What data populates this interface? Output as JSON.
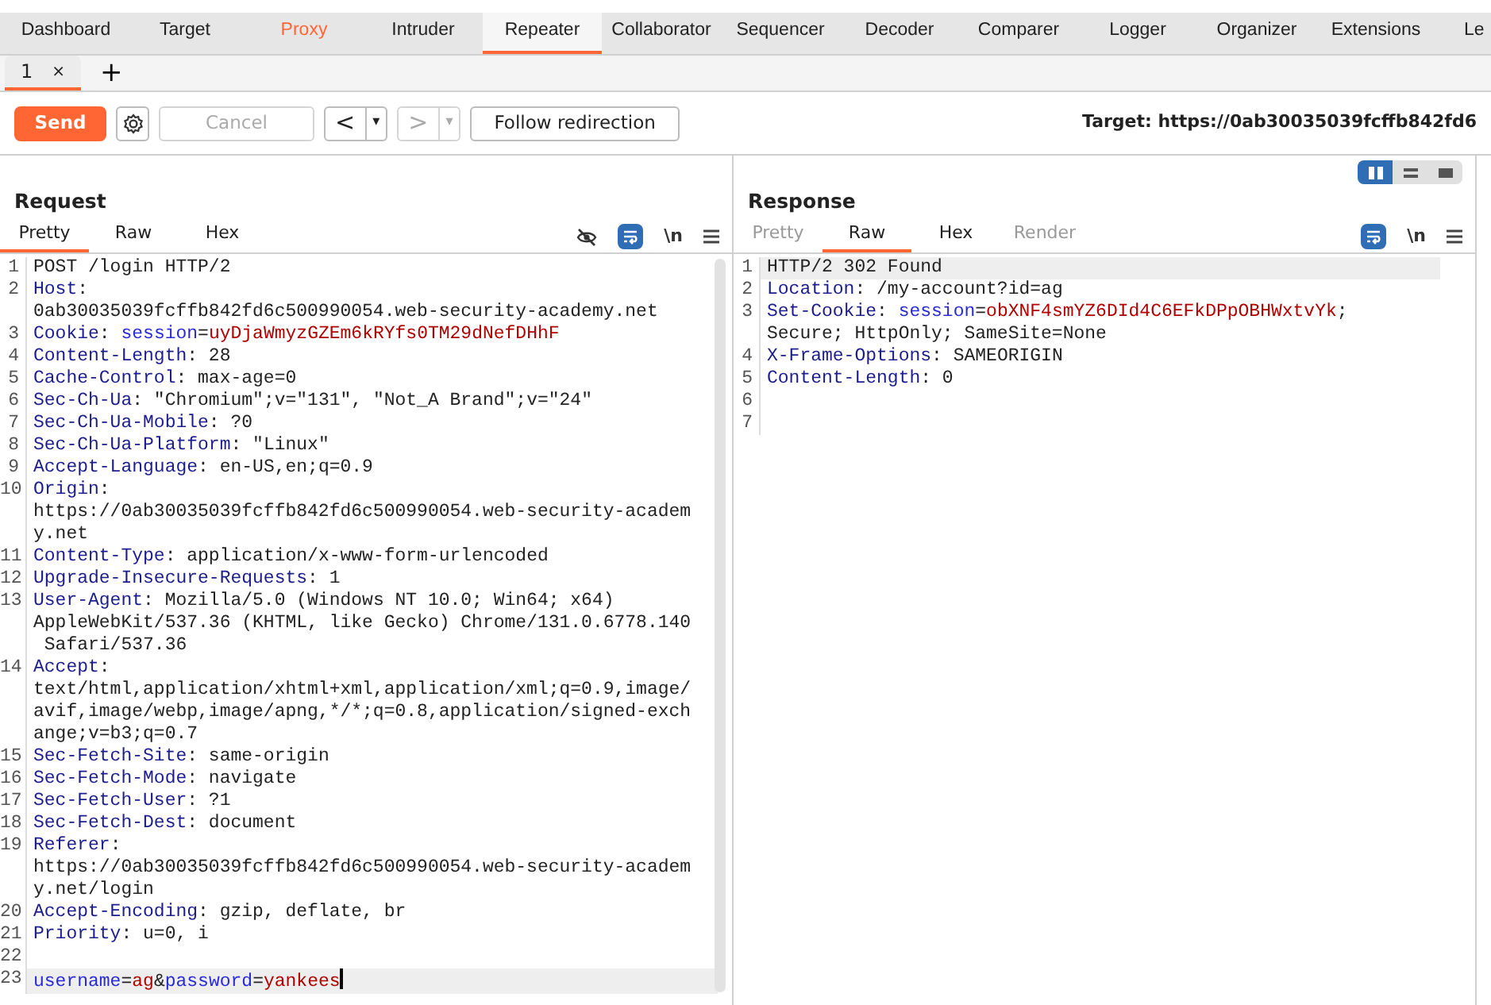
{
  "menu_tabs": [
    {
      "label": "Dashboard",
      "selected": false,
      "highlighted": false
    },
    {
      "label": "Target",
      "selected": false,
      "highlighted": false
    },
    {
      "label": "Proxy",
      "selected": false,
      "highlighted": true
    },
    {
      "label": "Intruder",
      "selected": false,
      "highlighted": false
    },
    {
      "label": "Repeater",
      "selected": true,
      "highlighted": false
    },
    {
      "label": "Collaborator",
      "selected": false,
      "highlighted": false
    },
    {
      "label": "Sequencer",
      "selected": false,
      "highlighted": false
    },
    {
      "label": "Decoder",
      "selected": false,
      "highlighted": false
    },
    {
      "label": "Comparer",
      "selected": false,
      "highlighted": false
    },
    {
      "label": "Logger",
      "selected": false,
      "highlighted": false
    },
    {
      "label": "Organizer",
      "selected": false,
      "highlighted": false
    },
    {
      "label": "Extensions",
      "selected": false,
      "highlighted": false
    },
    {
      "label": "Le",
      "selected": false,
      "highlighted": false
    }
  ],
  "repeater_tabs": [
    {
      "label": "1",
      "close": "×",
      "selected": true
    }
  ],
  "add_tab": "+",
  "toolbar": {
    "send": "Send",
    "cancel": {
      "label": "Cancel",
      "disabled": true
    },
    "back": {
      "label": "<",
      "menu": "▾",
      "disabled": false
    },
    "forward": {
      "label": ">",
      "menu": "▾",
      "disabled": true
    },
    "follow": "Follow redirection",
    "target": "Target: https://0ab30035039fcffb842fd6"
  },
  "request": {
    "title": "Request",
    "tabs": [
      {
        "label": "Pretty",
        "selected": true,
        "disabled": false
      },
      {
        "label": "Raw",
        "selected": false,
        "disabled": false
      },
      {
        "label": "Hex",
        "selected": false,
        "disabled": false
      }
    ],
    "newline": "\\n",
    "wrap_on": true,
    "lines": [
      {
        "n": "1",
        "current": false,
        "parts": [
          {
            "kind": "plain",
            "text": "POST /login HTTP/2"
          }
        ]
      },
      {
        "n": "2",
        "current": false,
        "parts": [
          {
            "kind": "key",
            "text": "Host"
          },
          {
            "kind": "plain",
            "text": ": 0ab30035039fcffb842fd6c500990054.web-security-academy.net"
          }
        ]
      },
      {
        "n": "3",
        "current": false,
        "parts": [
          {
            "kind": "key",
            "text": "Cookie"
          },
          {
            "kind": "plain",
            "text": ": "
          },
          {
            "kind": "attr",
            "text": "session"
          },
          {
            "kind": "plain",
            "text": "="
          },
          {
            "kind": "val",
            "text": "uyDjaWmyzGZEm6kRYfs0TM29dNefDHhF"
          }
        ]
      },
      {
        "n": "4",
        "current": false,
        "parts": [
          {
            "kind": "key",
            "text": "Content-Length"
          },
          {
            "kind": "plain",
            "text": ": 28"
          }
        ]
      },
      {
        "n": "5",
        "current": false,
        "parts": [
          {
            "kind": "key",
            "text": "Cache-Control"
          },
          {
            "kind": "plain",
            "text": ": max-age=0"
          }
        ]
      },
      {
        "n": "6",
        "current": false,
        "parts": [
          {
            "kind": "key",
            "text": "Sec-Ch-Ua"
          },
          {
            "kind": "plain",
            "text": ": \"Chromium\";v=\"131\", \"Not_A Brand\";v=\"24\""
          }
        ]
      },
      {
        "n": "7",
        "current": false,
        "parts": [
          {
            "kind": "key",
            "text": "Sec-Ch-Ua-Mobile"
          },
          {
            "kind": "plain",
            "text": ": ?0"
          }
        ]
      },
      {
        "n": "8",
        "current": false,
        "parts": [
          {
            "kind": "key",
            "text": "Sec-Ch-Ua-Platform"
          },
          {
            "kind": "plain",
            "text": ": \"Linux\""
          }
        ]
      },
      {
        "n": "9",
        "current": false,
        "parts": [
          {
            "kind": "key",
            "text": "Accept-Language"
          },
          {
            "kind": "plain",
            "text": ": en-US,en;q=0.9"
          }
        ]
      },
      {
        "n": "10",
        "current": false,
        "parts": [
          {
            "kind": "key",
            "text": "Origin"
          },
          {
            "kind": "plain",
            "text": ": https://0ab30035039fcffb842fd6c500990054.web-security-academy.net"
          }
        ]
      },
      {
        "n": "11",
        "current": false,
        "parts": [
          {
            "kind": "key",
            "text": "Content-Type"
          },
          {
            "kind": "plain",
            "text": ": application/x-www-form-urlencoded"
          }
        ]
      },
      {
        "n": "12",
        "current": false,
        "parts": [
          {
            "kind": "key",
            "text": "Upgrade-Insecure-Requests"
          },
          {
            "kind": "plain",
            "text": ": 1"
          }
        ]
      },
      {
        "n": "13",
        "current": false,
        "parts": [
          {
            "kind": "key",
            "text": "User-Agent"
          },
          {
            "kind": "plain",
            "text": ": Mozilla/5.0 (Windows NT 10.0; Win64; x64) AppleWebKit/537.36 (KHTML, like Gecko) Chrome/131.0.6778.140 Safari/537.36"
          }
        ]
      },
      {
        "n": "14",
        "current": false,
        "parts": [
          {
            "kind": "key",
            "text": "Accept"
          },
          {
            "kind": "plain",
            "text": ": text/html,application/xhtml+xml,application/xml;q=0.9,image/avif,image/webp,image/apng,*/*;q=0.8,application/signed-exchange;v=b3;q=0.7"
          }
        ]
      },
      {
        "n": "15",
        "current": false,
        "parts": [
          {
            "kind": "key",
            "text": "Sec-Fetch-Site"
          },
          {
            "kind": "plain",
            "text": ": same-origin"
          }
        ]
      },
      {
        "n": "16",
        "current": false,
        "parts": [
          {
            "kind": "key",
            "text": "Sec-Fetch-Mode"
          },
          {
            "kind": "plain",
            "text": ": navigate"
          }
        ]
      },
      {
        "n": "17",
        "current": false,
        "parts": [
          {
            "kind": "key",
            "text": "Sec-Fetch-User"
          },
          {
            "kind": "plain",
            "text": ": ?1"
          }
        ]
      },
      {
        "n": "18",
        "current": false,
        "parts": [
          {
            "kind": "key",
            "text": "Sec-Fetch-Dest"
          },
          {
            "kind": "plain",
            "text": ": document"
          }
        ]
      },
      {
        "n": "19",
        "current": false,
        "parts": [
          {
            "kind": "key",
            "text": "Referer"
          },
          {
            "kind": "plain",
            "text": ": https://0ab30035039fcffb842fd6c500990054.web-security-academy.net/login"
          }
        ]
      },
      {
        "n": "20",
        "current": false,
        "parts": [
          {
            "kind": "key",
            "text": "Accept-Encoding"
          },
          {
            "kind": "plain",
            "text": ": gzip, deflate, br"
          }
        ]
      },
      {
        "n": "21",
        "current": false,
        "parts": [
          {
            "kind": "key",
            "text": "Priority"
          },
          {
            "kind": "plain",
            "text": ": u=0, i"
          }
        ]
      },
      {
        "n": "22",
        "current": false
      },
      {
        "n": "23",
        "current": true,
        "parts": [
          {
            "kind": "attr",
            "text": "username"
          },
          {
            "kind": "plain",
            "text": "="
          },
          {
            "kind": "val",
            "text": "ag"
          },
          {
            "kind": "plain",
            "text": "&"
          },
          {
            "kind": "attr",
            "text": "password"
          },
          {
            "kind": "plain",
            "text": "="
          },
          {
            "kind": "val",
            "text": "yankees"
          }
        ]
      }
    ]
  },
  "response": {
    "title": "Response",
    "layout_buttons": [
      {
        "kind": "columns",
        "selected": true
      },
      {
        "kind": "rows",
        "selected": false
      },
      {
        "kind": "single",
        "selected": false
      }
    ],
    "tabs": [
      {
        "label": "Pretty",
        "selected": false,
        "disabled": true
      },
      {
        "label": "Raw",
        "selected": true,
        "disabled": false
      },
      {
        "label": "Hex",
        "selected": false,
        "disabled": false
      },
      {
        "label": "Render",
        "selected": false,
        "disabled": true
      }
    ],
    "newline": "\\n",
    "wrap_on": true,
    "lines": [
      {
        "n": "1",
        "current": true,
        "parts": [
          {
            "kind": "plain",
            "text": "HTTP/2 302 Found"
          }
        ]
      },
      {
        "n": "2",
        "current": false,
        "parts": [
          {
            "kind": "key",
            "text": "Location"
          },
          {
            "kind": "plain",
            "text": ": /my-account?id=ag"
          }
        ]
      },
      {
        "n": "3",
        "current": false,
        "parts": [
          {
            "kind": "key",
            "text": "Set-Cookie"
          },
          {
            "kind": "plain",
            "text": ": "
          },
          {
            "kind": "attr",
            "text": "session"
          },
          {
            "kind": "plain",
            "text": "="
          },
          {
            "kind": "val",
            "text": "obXNF4smYZ6DId4C6EFkDPpOBHWxtvYk"
          },
          {
            "kind": "plain",
            "text": "; Secure; HttpOnly; SameSite=None"
          }
        ]
      },
      {
        "n": "4",
        "current": false,
        "parts": [
          {
            "kind": "key",
            "text": "X-Frame-Options"
          },
          {
            "kind": "plain",
            "text": ": SAMEORIGIN"
          }
        ]
      },
      {
        "n": "5",
        "current": false,
        "parts": [
          {
            "kind": "key",
            "text": "Content-Length"
          },
          {
            "kind": "plain",
            "text": ": 0"
          }
        ]
      },
      {
        "n": "6",
        "current": false
      },
      {
        "n": "7",
        "current": false
      }
    ]
  }
}
